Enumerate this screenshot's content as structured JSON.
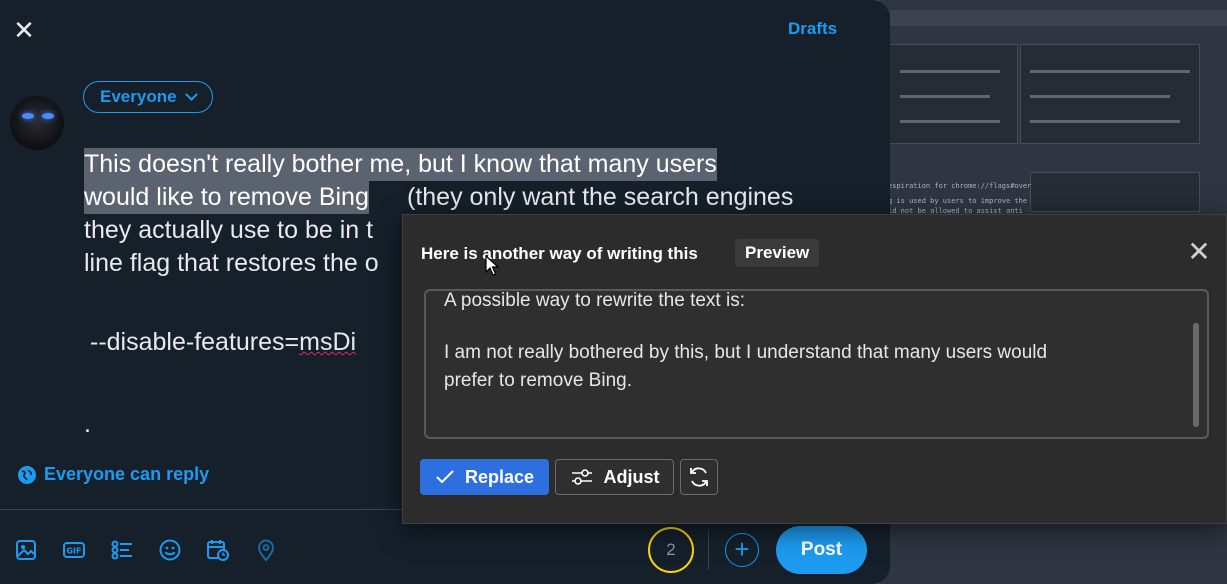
{
  "compose": {
    "drafts_label": "Drafts",
    "audience_label": "Everyone",
    "reply_setting_label": "Everyone can reply",
    "tweet_lines": [
      "This doesn't really bother me, but I know that many users",
      "would like to remove Bing",
      "(they only want the search engines",
      "they actually use to be in t",
      "line flag that restores the o"
    ],
    "flag_line_prefix": "--disable-features=",
    "flag_line_underlined": "msDi",
    "dot_line": ".",
    "char_counter": "2",
    "add_label": "+",
    "post_label": "Post"
  },
  "background": {
    "mono_lines": [
      "espiration for chrome://flags#over",
      "g is used by users to improve the",
      "ld not be allowed to assist anti"
    ]
  },
  "rewrite_popup": {
    "title": "Here is another way of writing this",
    "preview_tag": "Preview",
    "result_lines": [
      "A possible way to rewrite the text is:",
      "I am not really bothered by this, but I understand that many users would",
      "prefer to remove Bing."
    ],
    "replace_label": "Replace",
    "adjust_label": "Adjust"
  },
  "colors": {
    "twitter_blue": "#1d9bf0",
    "compose_bg": "#15202b",
    "popup_bg": "#2c2c2c",
    "replace_blue": "#2e6fe0",
    "counter_ring": "#ffd400"
  },
  "icons": {
    "toolbar": [
      "image-icon",
      "gif-icon",
      "poll-icon",
      "emoji-icon",
      "schedule-icon",
      "location-icon"
    ]
  }
}
